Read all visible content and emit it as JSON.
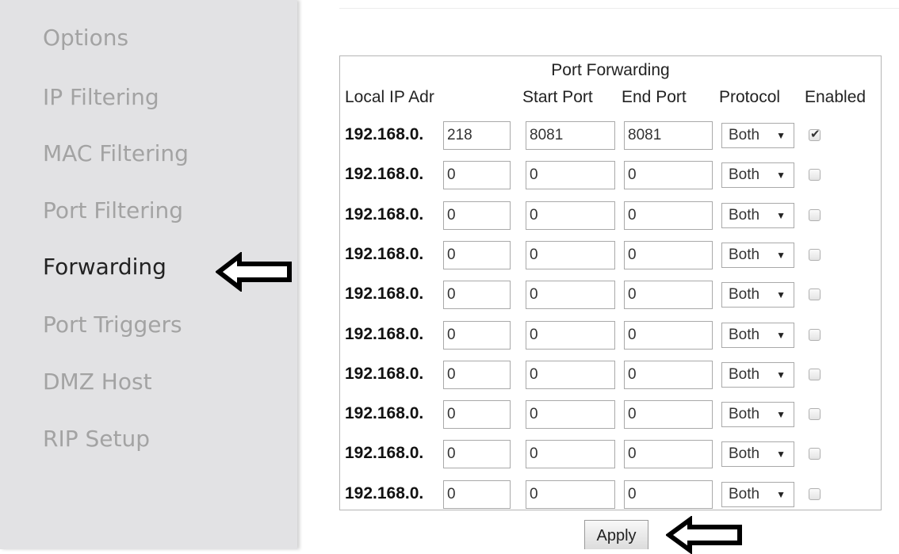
{
  "sidebar": {
    "items": [
      {
        "label": "Options",
        "active": false
      },
      {
        "label": "IP Filtering",
        "active": false
      },
      {
        "label": "MAC Filtering",
        "active": false
      },
      {
        "label": "Port Filtering",
        "active": false
      },
      {
        "label": "Forwarding",
        "active": true
      },
      {
        "label": "Port Triggers",
        "active": false
      },
      {
        "label": "DMZ Host",
        "active": false
      },
      {
        "label": "RIP Setup",
        "active": false
      }
    ]
  },
  "forwarding": {
    "title": "Port Forwarding",
    "headers": {
      "local_ip": "Local IP Adr",
      "start_port": "Start Port",
      "end_port": "End Port",
      "protocol": "Protocol",
      "enabled": "Enabled"
    },
    "ip_prefix": "192.168.0.",
    "rows": [
      {
        "ip_last": "218",
        "start": "8081",
        "end": "8081",
        "protocol": "Both",
        "enabled": true
      },
      {
        "ip_last": "0",
        "start": "0",
        "end": "0",
        "protocol": "Both",
        "enabled": false
      },
      {
        "ip_last": "0",
        "start": "0",
        "end": "0",
        "protocol": "Both",
        "enabled": false
      },
      {
        "ip_last": "0",
        "start": "0",
        "end": "0",
        "protocol": "Both",
        "enabled": false
      },
      {
        "ip_last": "0",
        "start": "0",
        "end": "0",
        "protocol": "Both",
        "enabled": false
      },
      {
        "ip_last": "0",
        "start": "0",
        "end": "0",
        "protocol": "Both",
        "enabled": false
      },
      {
        "ip_last": "0",
        "start": "0",
        "end": "0",
        "protocol": "Both",
        "enabled": false
      },
      {
        "ip_last": "0",
        "start": "0",
        "end": "0",
        "protocol": "Both",
        "enabled": false
      },
      {
        "ip_last": "0",
        "start": "0",
        "end": "0",
        "protocol": "Both",
        "enabled": false
      },
      {
        "ip_last": "0",
        "start": "0",
        "end": "0",
        "protocol": "Both",
        "enabled": false
      }
    ],
    "apply_label": "Apply"
  },
  "icons": {
    "arrow": "arrow-left-icon",
    "checkmark": "checkmark-icon",
    "caret": "dropdown-caret-icon"
  },
  "colors": {
    "sidebar_bg": "#e2e2e4",
    "sidebar_text_inactive": "#a3a3a3",
    "sidebar_text_active": "#222222"
  }
}
